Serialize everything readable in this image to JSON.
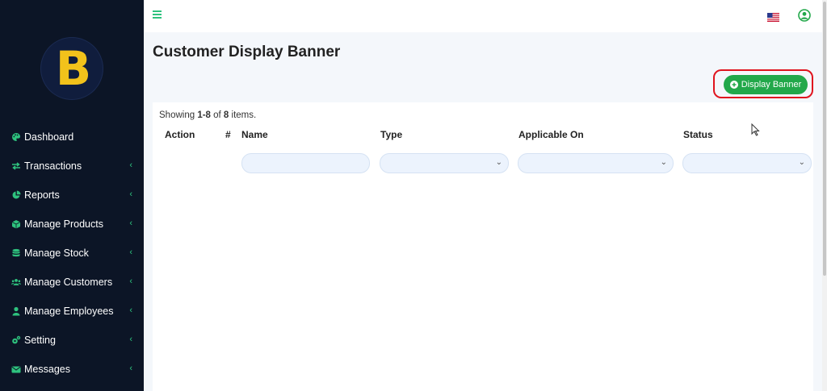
{
  "sidebar": {
    "logo_text": "B",
    "items": [
      {
        "label": "Dashboard",
        "icon": "palette-icon",
        "has_submenu": false
      },
      {
        "label": "Transactions",
        "icon": "exchange-icon",
        "has_submenu": true
      },
      {
        "label": "Reports",
        "icon": "pie-chart-icon",
        "has_submenu": true
      },
      {
        "label": "Manage Products",
        "icon": "cube-icon",
        "has_submenu": true
      },
      {
        "label": "Manage Stock",
        "icon": "database-icon",
        "has_submenu": true
      },
      {
        "label": "Manage Customers",
        "icon": "users-icon",
        "has_submenu": true
      },
      {
        "label": "Manage Employees",
        "icon": "user-icon",
        "has_submenu": true
      },
      {
        "label": "Setting",
        "icon": "cogs-icon",
        "has_submenu": true
      },
      {
        "label": "Messages",
        "icon": "envelope-icon",
        "has_submenu": true
      }
    ]
  },
  "header": {
    "title": "Customer Display Banner",
    "add_button_label": "Display Banner"
  },
  "table": {
    "summary_prefix": "Showing ",
    "summary_range": "1-8",
    "summary_middle": " of ",
    "summary_total": "8",
    "summary_suffix": " items.",
    "columns": [
      "Action",
      "#",
      "Name",
      "Type",
      "Applicable On",
      "Status"
    ]
  },
  "colors": {
    "sidebar_bg": "#0c1526",
    "accent": "#2ec27e",
    "button_bg": "#22a84a",
    "highlight": "#e0141e"
  }
}
